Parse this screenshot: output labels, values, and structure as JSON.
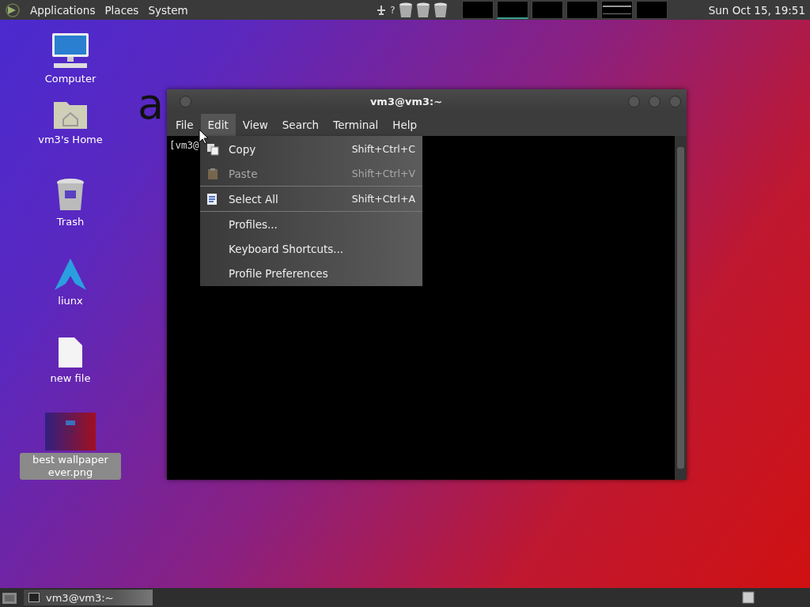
{
  "top_panel": {
    "menus": [
      "Applications",
      "Places",
      "System"
    ],
    "tray_help": "?",
    "workspaces": [
      {
        "selected": false,
        "has_window": false
      },
      {
        "selected": true,
        "has_window": false
      },
      {
        "selected": false,
        "has_window": false
      },
      {
        "selected": false,
        "has_window": false
      },
      {
        "selected": false,
        "has_window": true
      },
      {
        "selected": false,
        "has_window": false
      }
    ],
    "clock": "Sun Oct 15, 19:51"
  },
  "desktop": {
    "stray_text": "a",
    "icons": [
      {
        "kind": "computer",
        "label": "Computer",
        "selected": false
      },
      {
        "kind": "home",
        "label": "vm3's Home",
        "selected": false
      },
      {
        "kind": "trash",
        "label": "Trash",
        "selected": false
      },
      {
        "kind": "arch",
        "label": "liunx",
        "selected": false
      },
      {
        "kind": "file",
        "label": "new file",
        "selected": false
      },
      {
        "label": "best wallpaper ever.png",
        "selected": true
      }
    ]
  },
  "window": {
    "title": "vm3@vm3:~",
    "menus": [
      {
        "label": "File",
        "selected": false
      },
      {
        "label": "Edit",
        "selected": true
      },
      {
        "label": "View",
        "selected": false
      },
      {
        "label": "Search",
        "selected": false
      },
      {
        "label": "Terminal",
        "selected": false
      },
      {
        "label": "Help",
        "selected": false
      }
    ],
    "terminal_text": "[vm3@",
    "edit_menu": [
      {
        "kind": "iconitem",
        "label": "Copy",
        "shortcut": "Shift+Ctrl+C",
        "disabled": false
      },
      {
        "kind": "iconitem",
        "label": "Paste",
        "shortcut": "Shift+Ctrl+V",
        "disabled": true
      },
      {
        "kind": "separator"
      },
      {
        "kind": "iconitem",
        "label": "Select All",
        "shortcut": "Shift+Ctrl+A",
        "disabled": false
      },
      {
        "kind": "separator"
      },
      {
        "kind": "item",
        "label": "Profiles...",
        "disabled": false
      },
      {
        "kind": "item",
        "label": "Keyboard Shortcuts...",
        "disabled": false
      },
      {
        "kind": "item",
        "label": "Profile Preferences",
        "disabled": false
      }
    ]
  },
  "bottom_panel": {
    "tasks": [
      {
        "label": "vm3@vm3:~",
        "selected": false
      }
    ]
  }
}
